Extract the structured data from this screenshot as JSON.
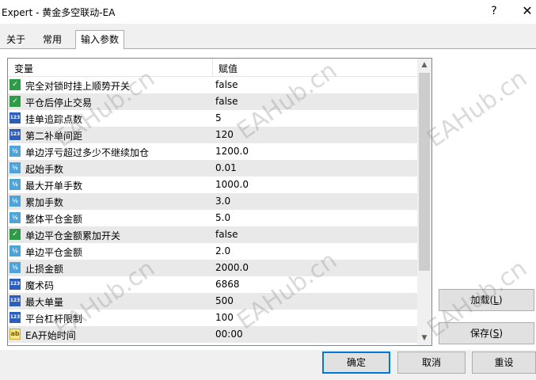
{
  "window": {
    "title": "Expert - 黄金多空联动-EA",
    "help_label": "?",
    "close_label": "✕"
  },
  "tabs": [
    {
      "label": "关于"
    },
    {
      "label": "常用"
    },
    {
      "label": "输入参数"
    }
  ],
  "grid": {
    "columns": {
      "name": "变量",
      "value": "赋值"
    },
    "rows": [
      {
        "type": "bool",
        "icon": "boolean-icon",
        "name": "完全对锁时挂上顺势开关",
        "value": "false"
      },
      {
        "type": "bool",
        "icon": "boolean-icon",
        "name": "平仓后停止交易",
        "value": "false"
      },
      {
        "type": "int",
        "icon": "integer-icon",
        "name": "挂单追踪点数",
        "value": "5"
      },
      {
        "type": "int",
        "icon": "integer-icon",
        "name": "第二补单间距",
        "value": "120"
      },
      {
        "type": "dbl",
        "icon": "double-icon",
        "name": "单边浮亏超过多少不继续加仓",
        "value": "1200.0"
      },
      {
        "type": "dbl",
        "icon": "double-icon",
        "name": "起始手数",
        "value": "0.01"
      },
      {
        "type": "dbl",
        "icon": "double-icon",
        "name": "最大开单手数",
        "value": "1000.0"
      },
      {
        "type": "dbl",
        "icon": "double-icon",
        "name": "累加手数",
        "value": "3.0"
      },
      {
        "type": "dbl",
        "icon": "double-icon",
        "name": "整体平仓金额",
        "value": "5.0"
      },
      {
        "type": "bool",
        "icon": "boolean-icon",
        "name": "单边平仓金额累加开关",
        "value": "false"
      },
      {
        "type": "dbl",
        "icon": "double-icon",
        "name": "单边平仓金额",
        "value": "2.0"
      },
      {
        "type": "dbl",
        "icon": "double-icon",
        "name": "止损金额",
        "value": "2000.0"
      },
      {
        "type": "int",
        "icon": "integer-icon",
        "name": "魔术码",
        "value": "6868"
      },
      {
        "type": "int",
        "icon": "integer-icon",
        "name": "最大单量",
        "value": "500"
      },
      {
        "type": "int",
        "icon": "integer-icon",
        "name": "平台杠杆限制",
        "value": "100"
      },
      {
        "type": "str",
        "icon": "string-icon",
        "name": "EA开始时间",
        "value": "00:00"
      }
    ],
    "icon_glyphs": {
      "bool": "✓",
      "int": "123",
      "dbl": "½",
      "str": "ab"
    }
  },
  "scrollbar": {
    "up": "▲",
    "down": "▼"
  },
  "buttons": {
    "load": {
      "label": "加载(",
      "hotkey": "L",
      "suffix": ")"
    },
    "save": {
      "label": "保存(",
      "hotkey": "S",
      "suffix": ")"
    },
    "ok": "确定",
    "cancel": "取消",
    "reset": "重设"
  },
  "watermark": {
    "text_a": "EAHub.cn",
    "text_b": "EAHub.cn"
  },
  "colors": {
    "accent": "#0078d7",
    "bool_icon": "#2f9a47",
    "int_icon": "#2e5fb8",
    "double_icon": "#4ea3d8",
    "string_icon": "#f2e58a"
  }
}
